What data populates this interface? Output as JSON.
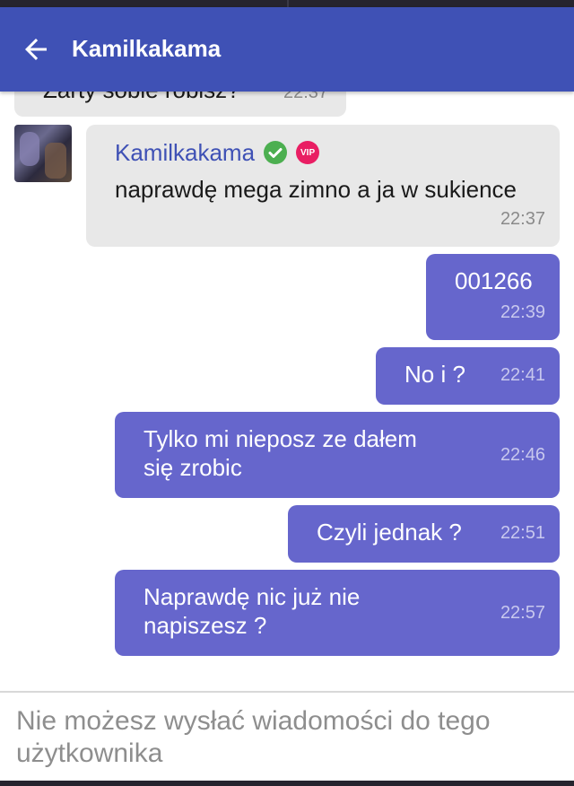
{
  "app_bar": {
    "title": "Kamilkakama",
    "background": "#3f51b5",
    "back_icon": "arrow-left-icon"
  },
  "messages": [
    {
      "direction": "in",
      "text": "Żarty sobie robisz?",
      "time": "22:37",
      "partial": true
    },
    {
      "direction": "in",
      "sender": "Kamilkakama",
      "verified": true,
      "badge": "VIP",
      "text": "naprawdę mega zimno a ja w sukience",
      "time": "22:37"
    },
    {
      "direction": "out",
      "lines": [
        "001266"
      ],
      "time": "22:39"
    },
    {
      "direction": "out",
      "lines": [
        "No i ?"
      ],
      "time": "22:41"
    },
    {
      "direction": "out",
      "lines": [
        "Tylko mi nieposz ze dałem",
        "się zrobic"
      ],
      "time": "22:46"
    },
    {
      "direction": "out",
      "lines": [
        "Czyli jednak ?"
      ],
      "time": "22:51"
    },
    {
      "direction": "out",
      "lines": [
        "Naprawdę nic już nie",
        "napiszesz ?"
      ],
      "time": "22:57"
    }
  ],
  "composer": {
    "notice": "Nie możesz wysłać wiadomości do tego użytkownika"
  },
  "colors": {
    "incoming_bubble": "#e8e8e8",
    "outgoing_bubble": "#6666cc",
    "sender_name": "#3f51b5",
    "verified": "#4caf50",
    "vip": "#e91e63"
  }
}
